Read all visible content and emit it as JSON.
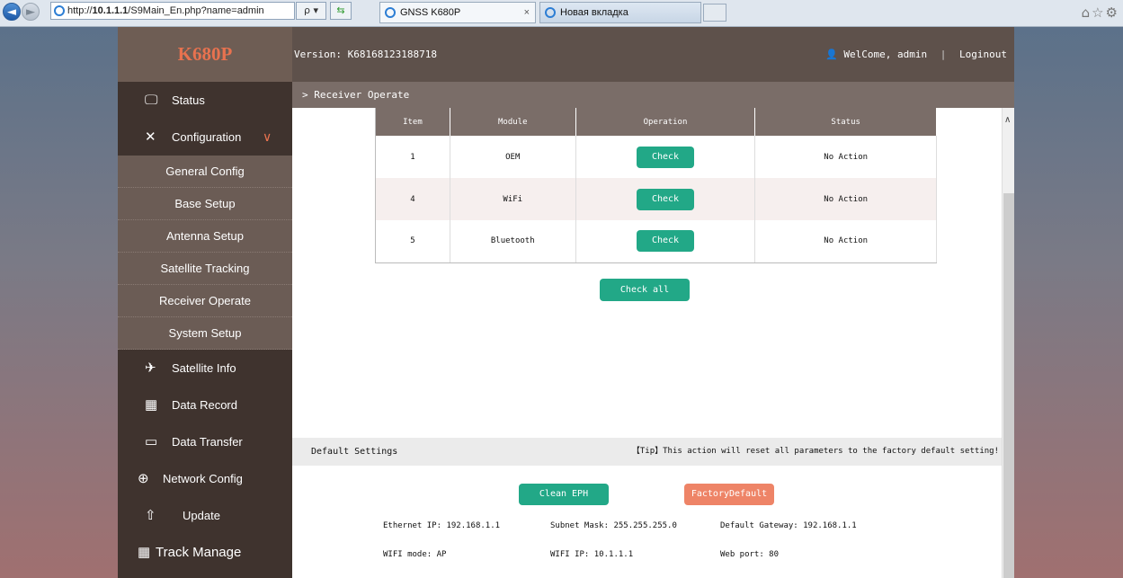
{
  "browser": {
    "url_prefix": "http://",
    "url_host": "10.1.1.1",
    "url_path": "/S9Main_En.php?name=admin",
    "search_glyph": "ρ ▾",
    "tabs": [
      {
        "label": "GNSS K680P",
        "close": "×"
      },
      {
        "label": "Новая вкладка"
      }
    ]
  },
  "header": {
    "brand": "K680P",
    "version": "Version: K68168123188718",
    "welcome": "WelCome, admin",
    "separator": "|",
    "logout": "Loginout"
  },
  "sidebar": {
    "status": "Status",
    "configuration": "Configuration",
    "sub_items": [
      "General Config",
      "Base Setup",
      "Antenna Setup",
      "Satellite Tracking",
      "Receiver Operate",
      "System Setup"
    ],
    "satellite_info": "Satellite Info",
    "data_record": "Data Record",
    "data_transfer": "Data Transfer",
    "network_config": "Network Config",
    "update": "Update",
    "track_manage": "Track Manage"
  },
  "breadcrumb": "> Receiver Operate",
  "table": {
    "headers": [
      "Item",
      "Module",
      "Operation",
      "Status"
    ],
    "rows": [
      {
        "item": "1",
        "module": "OEM",
        "operation": "Check",
        "status": "No Action"
      },
      {
        "item": "4",
        "module": "WiFi",
        "operation": "Check",
        "status": "No Action"
      },
      {
        "item": "5",
        "module": "Bluetooth",
        "operation": "Check",
        "status": "No Action"
      }
    ]
  },
  "check_all": "Check all",
  "default_settings": {
    "title": "Default Settings",
    "tip": "【Tip】This action will reset all parameters to the factory default setting!",
    "clean_eph": "Clean EPH",
    "factory_default": "FactoryDefault"
  },
  "network_info": {
    "ethernet_ip": "Ethernet IP: 192.168.1.1",
    "subnet_mask": "Subnet Mask: 255.255.255.0",
    "default_gateway": "Default Gateway: 192.168.1.1",
    "wifi_mode": "WIFI mode: AP",
    "wifi_ip": "WIFI IP: 10.1.1.1",
    "web_port": "Web port: 80"
  },
  "colors": {
    "brand": "#e8724f",
    "accent_green": "#22a887",
    "factory_orange": "#ee8467",
    "sidebar_dark": "#3f332e",
    "sidebar_sub": "#6b5c55"
  }
}
